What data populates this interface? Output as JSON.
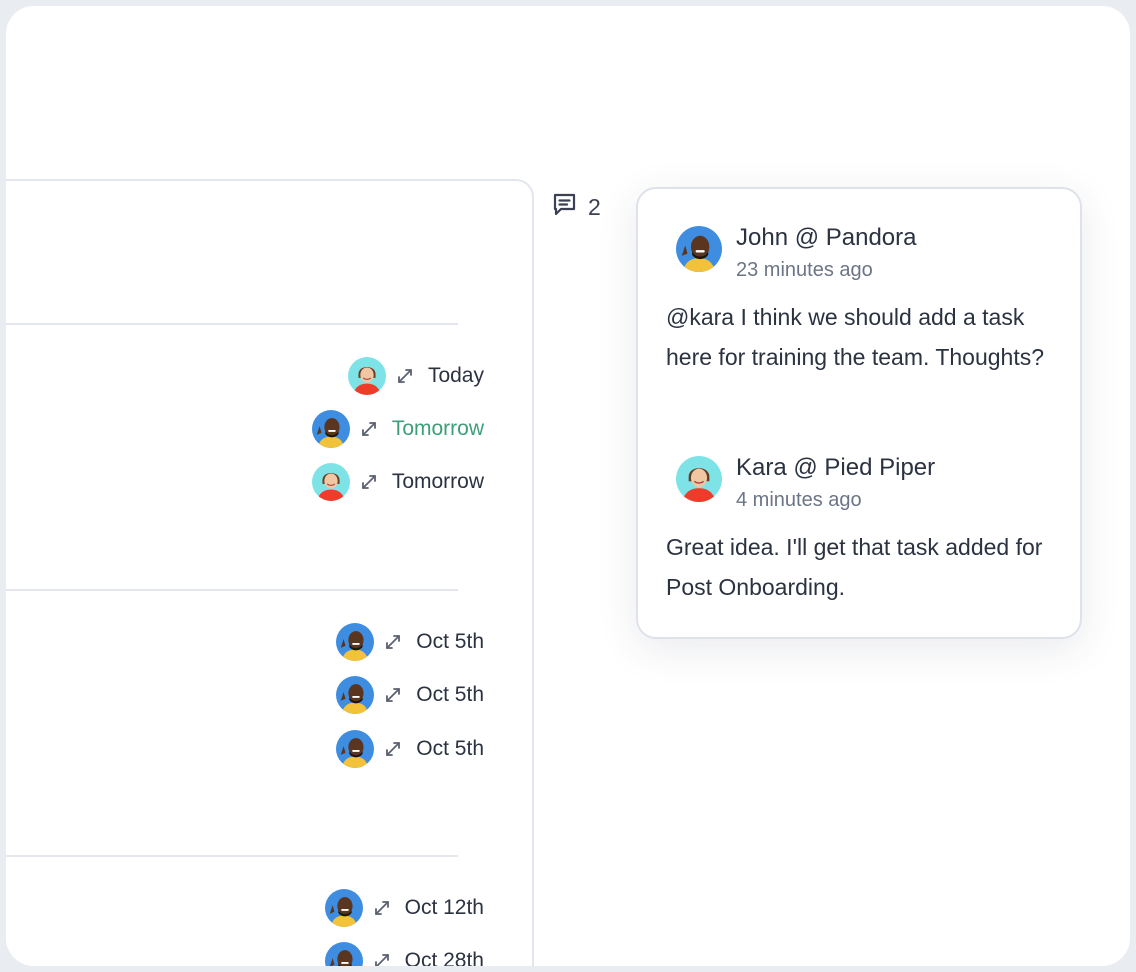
{
  "tasks": {
    "rows": [
      {
        "date": "Today",
        "avatar": "kara",
        "color": "#2b3240"
      },
      {
        "date": "Tomorrow",
        "avatar": "john",
        "color": "#3d9e78"
      },
      {
        "date": "Tomorrow",
        "avatar": "kara",
        "color": "#2b3240"
      },
      {
        "date": "Oct 5th",
        "avatar": "john",
        "color": "#2b3240"
      },
      {
        "date": "Oct 5th",
        "avatar": "john",
        "color": "#2b3240"
      },
      {
        "date": "Oct 5th",
        "avatar": "john",
        "color": "#2b3240"
      },
      {
        "date": "Oct 12th",
        "avatar": "john",
        "color": "#2b3240"
      },
      {
        "date": "Oct 28th",
        "avatar": "john",
        "color": "#2b3240"
      }
    ]
  },
  "comments": {
    "count_icon": "comment-icon",
    "count": "2",
    "items": [
      {
        "author": "John @ Pandora",
        "time": "23 minutes ago",
        "avatar": "john",
        "body": "@kara I think we should add a task here for training the team. Thoughts?"
      },
      {
        "author": "Kara @ Pied Piper",
        "time": "4 minutes ago",
        "avatar": "kara",
        "body": "Great idea. I'll get that task added for Post Onboarding."
      }
    ]
  },
  "colors": {
    "accent_green": "#3d9e78",
    "text": "#2b3240",
    "muted": "#6c7585",
    "border": "#e4e6ee"
  }
}
